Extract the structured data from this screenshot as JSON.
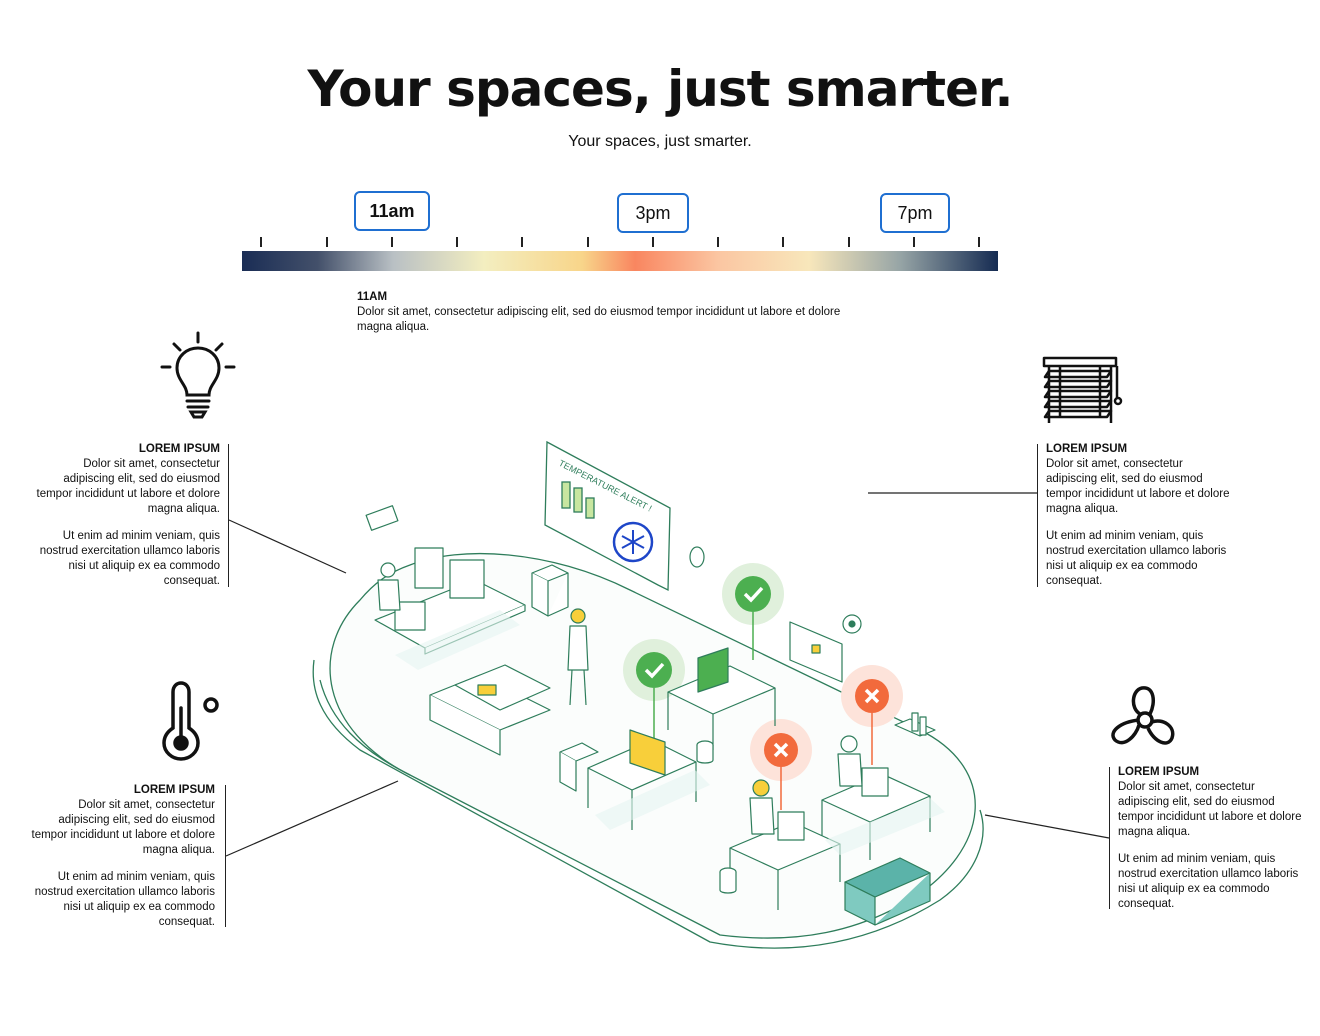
{
  "header": {
    "title": "Your spaces, just smarter.",
    "subtitle": "Your spaces, just smarter."
  },
  "timeline": {
    "buttons": [
      {
        "label": "11am",
        "active": true
      },
      {
        "label": "3pm",
        "active": false
      },
      {
        "label": "7pm",
        "active": false
      }
    ],
    "gradient_colors": [
      "#1a2d55",
      "#b9c0c4",
      "#f3eec0",
      "#f98660",
      "#f8e7bb",
      "#152b52"
    ],
    "selected": {
      "heading": "11AM",
      "text": "Dolor sit amet, consectetur adipiscing elit, sed do eiusmod tempor incididunt ut labore et dolore magna aliqua."
    }
  },
  "features": {
    "lighting": {
      "icon": "lightbulb-icon",
      "heading": "LOREM IPSUM",
      "p1": "Dolor sit amet, consectetur adipiscing elit, sed do eiusmod tempor incididunt ut labore et dolore magna aliqua.",
      "p2": "Ut enim ad minim veniam, quis nostrud exercitation ullamco laboris nisi ut aliquip ex ea commodo consequat."
    },
    "temperature": {
      "icon": "thermometer-icon",
      "heading": "LOREM IPSUM",
      "p1": "Dolor sit amet, consectetur adipiscing elit, sed do eiusmod tempor incididunt ut labore et dolore magna aliqua.",
      "p2": "Ut enim ad minim veniam, quis nostrud exercitation ullamco laboris nisi ut aliquip ex ea commodo consequat."
    },
    "blinds": {
      "icon": "window-blinds-icon",
      "heading": "LOREM IPSUM",
      "p1": "Dolor sit amet, consectetur adipiscing elit, sed do eiusmod tempor incididunt ut labore et dolore magna aliqua.",
      "p2": "Ut enim ad minim veniam, quis nostrud exercitation ullamco laboris nisi ut aliquip ex ea commodo consequat."
    },
    "ventilation": {
      "icon": "fan-icon",
      "heading": "LOREM IPSUM",
      "p1": "Dolor sit amet, consectetur adipiscing elit, sed do eiusmod tempor incididunt ut labore et dolore magna aliqua.",
      "p2": "Ut enim ad minim veniam, quis nostrud exercitation ullamco laboris nisi ut aliquip ex ea commodo consequat."
    }
  },
  "scene": {
    "alert_text": "TEMPERATURE ALERT !",
    "status_ok_color": "#4caf50",
    "status_bad_color": "#f26a3c",
    "line_color": "#2e7d5b"
  }
}
